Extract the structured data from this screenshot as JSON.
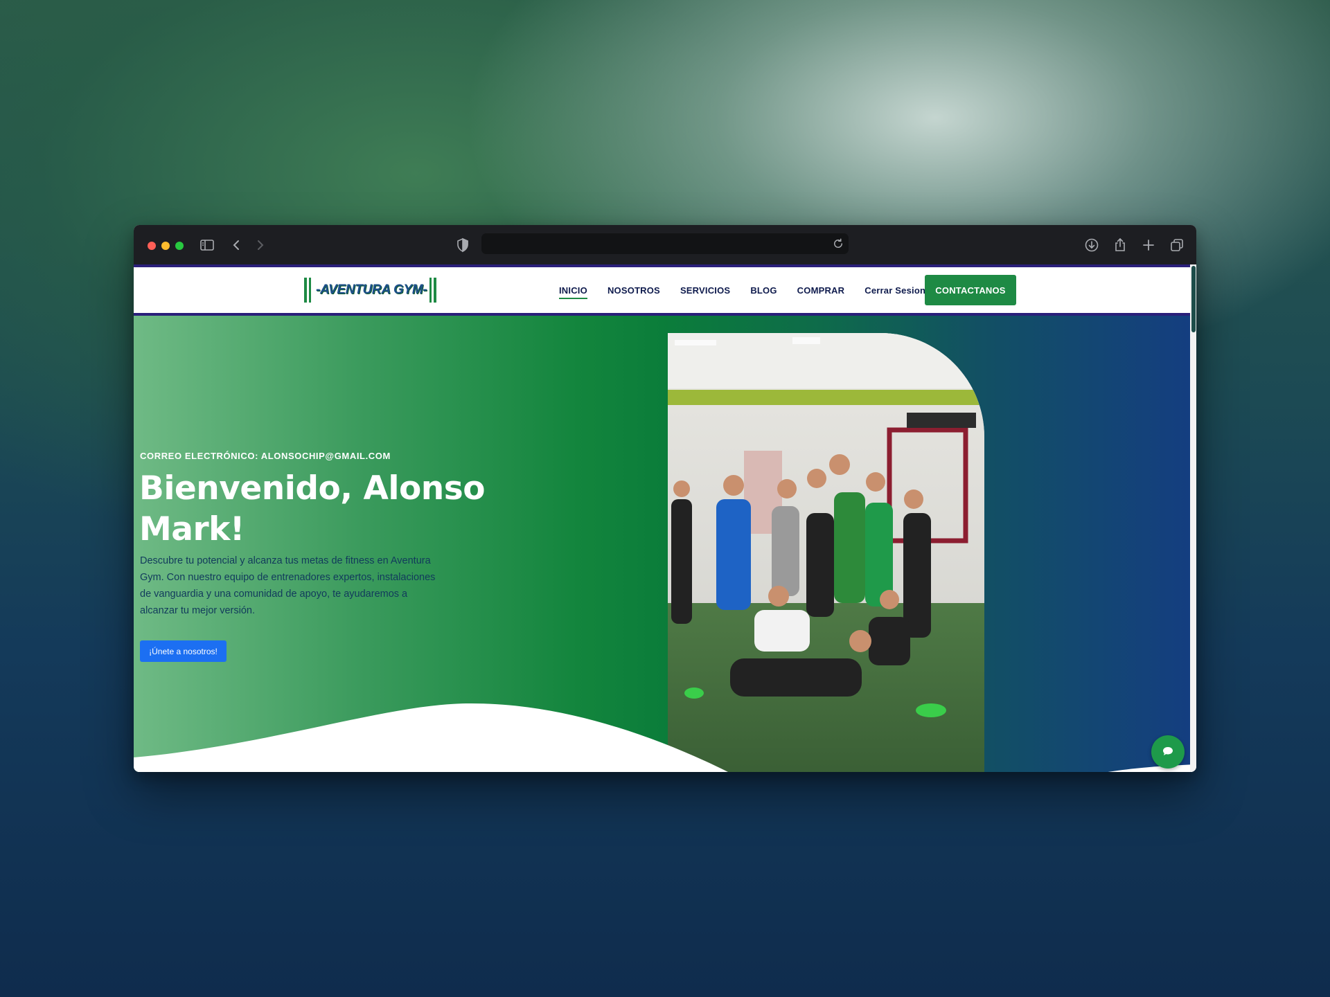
{
  "browser": {
    "url": "",
    "icons": [
      "sidebar-icon",
      "back-icon",
      "forward-icon",
      "shield-icon",
      "reload-icon",
      "download-icon",
      "share-icon",
      "new-tab-icon",
      "tabs-overview-icon"
    ]
  },
  "navbar": {
    "logo_text": "-AVENTURA GYM-",
    "links": [
      "INICIO",
      "NOSOTROS",
      "SERVICIOS",
      "BLOG",
      "COMPRAR",
      "Cerrar Sesion"
    ],
    "active_link": "INICIO",
    "cta_label": "CONTACTANOS"
  },
  "hero": {
    "email_line": "CORREO ELECTRÓNICO: ALONSOCHIP@GMAIL.COM",
    "title": "Bienvenido, Alonso Mark!",
    "description": "Descubre tu potencial y alcanza tus metas de fitness en Aventura Gym. Con nuestro equipo de entrenadores expertos, instalaciones de vanguardia y una comunidad de apoyo, te ayudaremos a alcanzar tu mejor versión.",
    "button_label": "¡Únete a nosotros!"
  },
  "colors": {
    "brand_green": "#1e8a44",
    "navy": "#0f1b4d",
    "cta_blue": "#1c6ff2",
    "nav_border": "#2a1f7a"
  },
  "chat": {
    "icon": "chat-bubble-icon"
  }
}
